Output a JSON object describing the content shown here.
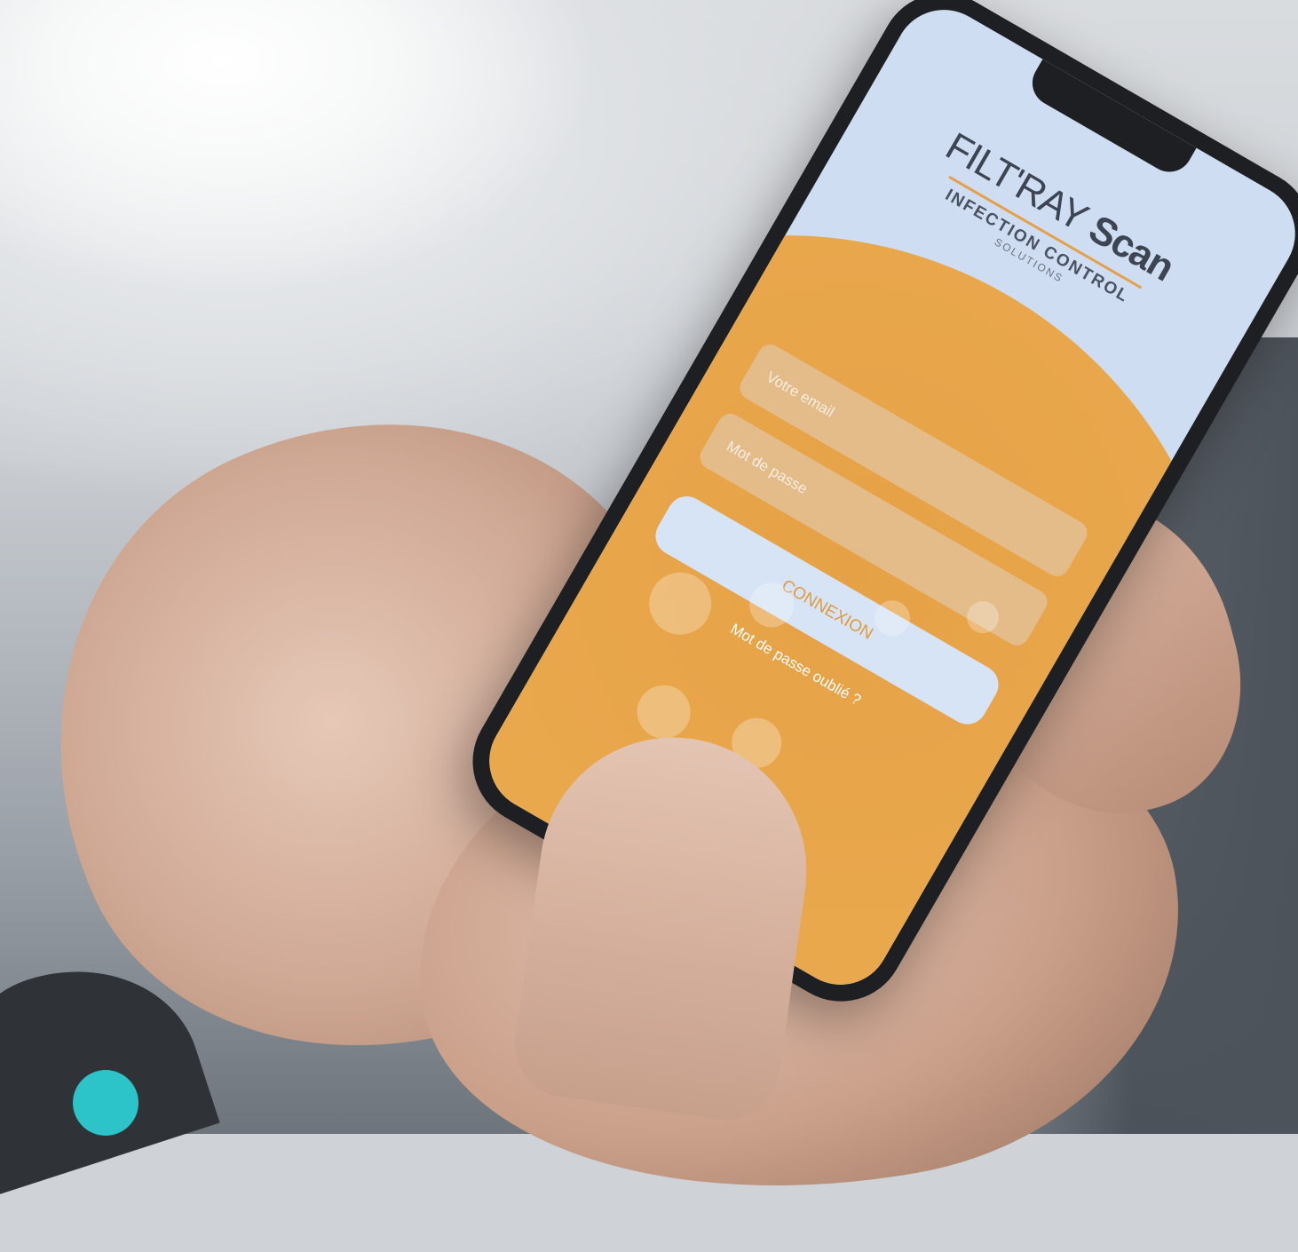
{
  "app": {
    "logo": {
      "title_light": "FILT'RAY",
      "title_bold": "Scan",
      "subtitle": "INFECTION CONTROL",
      "tagline": "SOLUTIONS"
    },
    "form": {
      "email_placeholder": "Votre email",
      "password_placeholder": "Mot de passe",
      "login_button": "CONNEXION",
      "forgot_link": "Mot de passe oublié ?"
    }
  },
  "colors": {
    "accent_orange": "#e6a146",
    "screen_background": "#cfddf2",
    "badge_teal": "#2cc4c8"
  }
}
